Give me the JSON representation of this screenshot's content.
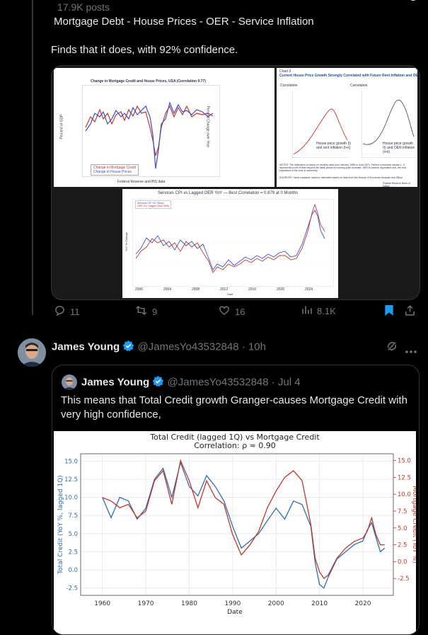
{
  "header": {
    "posts_count": "17.9K posts"
  },
  "post1": {
    "title": "Mortgage Debt - House Prices - OER - Service Inflation",
    "body": "Finds that it does, with 92% confidence.",
    "images": {
      "img1": {
        "title": "Change in Mortgage Credit and House Prices, USA (Correlation 0.77)",
        "ylabel_left": "Percent of GDP",
        "ylabel_right": "Percent Change over Year",
        "legend": [
          "Change in Mortgage Credit",
          "Change in House Prices"
        ],
        "source": "Federal Reserve and BIS data"
      },
      "img2": {
        "chart_label": "Chart 3",
        "title": "Current House Price Growth Strongly Correlated with Future Rent Inflation and OER Inflation",
        "panel_y_label": "Correlation",
        "panel1_legend": "House price growth (t) and rent inflation (t+k)",
        "panel2_legend": "House price growth (t) and OER inflation (t+k)",
        "x_ticks": [
          "-40",
          "-20",
          "0",
          "20",
          "40"
        ],
        "y_ticks": [
          "0.8",
          "0.7",
          "0.6",
          "0.5",
          "0.4",
          "0.3",
          "0.2",
          "0.1",
          "0.0",
          "-0.1",
          "-0.2"
        ],
        "notes": "NOTES: The estimation is based on monthly data from January 1986 to June 2021. Perfect correlation equals 1. 'k' represents a unit of time beyond the initial period of housing price increase. OER is owners' equivalent rent, the rent equivalent of the cost of ownership.",
        "sources": "SOURCES: Haver Analytics; authors' estimates based on data from the Bureau of Economic Analysis and Zillow.",
        "footer": "Federal Reserve Bank of Dallas"
      },
      "img3": {
        "title": "Services CPI vs Lagged OER YoY — Best Correlation = 0.879 at 0 Months",
        "legend": [
          "Services CPI YoY (Blue)",
          "OER YoY Lagged (Red-Shift)"
        ],
        "xlabel": "Date",
        "ylabel": "YoY % Change",
        "x_ticks": [
          "2000",
          "2004",
          "2008",
          "2012",
          "2016",
          "2020",
          "2024"
        ],
        "y_ticks": [
          "0",
          "2",
          "4",
          "6",
          "8"
        ]
      }
    },
    "actions": {
      "replies": "11",
      "reposts": "9",
      "likes": "16",
      "views": "8.1K"
    }
  },
  "post2": {
    "author_name": "James Young",
    "handle_time": "@JamesYo43532848 · 10h",
    "quote": {
      "author_name": "James Young",
      "handle_time": "@JamesYo43532848 · Jul 4",
      "text": "This means that Total Credit growth Granger-causes Mortgage Credit with very high confidence,"
    }
  },
  "colors": {
    "blue": "#2f6db5",
    "red": "#c0392b",
    "verified": "#1d9bf0",
    "bg": "#000000"
  },
  "chart_data": {
    "type": "line",
    "title": "Total Credit (lagged 1Q) vs Mortgage Credit",
    "subtitle": "Correlation: ρ ≈ 0.90",
    "xlabel": "Date",
    "ylabel_left": "Total Credit (YoY %, lagged 1Q)",
    "ylabel_right": "Mortgage Credit (YoY %)",
    "x_ticks": [
      1960,
      1970,
      1980,
      1990,
      2000,
      2010,
      2020
    ],
    "y_ticks_left": [
      -2.5,
      0.0,
      2.5,
      5.0,
      7.5,
      10.0,
      12.5,
      15.0
    ],
    "y_ticks_right": [
      -2.5,
      0.0,
      2.5,
      5.0,
      7.5,
      10.0,
      12.5,
      15.0
    ],
    "xlim": [
      1955,
      2027
    ],
    "ylim_left": [
      -3.5,
      16.0
    ],
    "ylim_right": [
      -5.0,
      16.0
    ],
    "grid": true,
    "series": [
      {
        "axis": "left",
        "x": [
          1960,
          1962,
          1964,
          1966,
          1968,
          1970,
          1972,
          1974,
          1976,
          1978,
          1980,
          1982,
          1984,
          1986,
          1988,
          1990,
          1992,
          1994,
          1996,
          1998,
          2000,
          2002,
          2004,
          2006,
          2008,
          2009,
          2010,
          2011,
          2012,
          2014,
          2016,
          2018,
          2020,
          2021,
          2022,
          2023,
          2024,
          2025
        ],
        "y": [
          10.0,
          7.2,
          10.0,
          9.5,
          7.0,
          8.5,
          12.5,
          14.0,
          10.0,
          14.8,
          11.5,
          10.2,
          13.0,
          11.5,
          9.5,
          6.0,
          3.0,
          4.0,
          5.0,
          6.8,
          8.5,
          7.0,
          9.5,
          9.0,
          6.0,
          1.0,
          -2.0,
          -2.5,
          -1.0,
          1.5,
          2.5,
          3.5,
          4.0,
          5.5,
          6.5,
          4.5,
          2.5,
          3.0
        ]
      },
      {
        "axis": "right",
        "x": [
          1960,
          1962,
          1964,
          1966,
          1968,
          1970,
          1972,
          1974,
          1976,
          1978,
          1980,
          1982,
          1984,
          1986,
          1988,
          1990,
          1992,
          1994,
          1996,
          1998,
          2000,
          2002,
          2004,
          2006,
          2008,
          2009,
          2010,
          2011,
          2012,
          2014,
          2016,
          2018,
          2020,
          2021,
          2022,
          2023,
          2024,
          2025
        ],
        "y": [
          9.5,
          9.0,
          8.0,
          8.5,
          6.5,
          7.5,
          12.0,
          13.5,
          8.5,
          15.0,
          12.0,
          8.0,
          12.0,
          9.5,
          8.5,
          4.0,
          1.0,
          2.5,
          4.5,
          8.0,
          10.5,
          12.5,
          13.5,
          12.0,
          5.5,
          0.5,
          -1.5,
          -2.5,
          -2.0,
          0.5,
          2.0,
          3.0,
          3.5,
          4.5,
          6.5,
          4.0,
          2.5,
          2.5
        ]
      }
    ]
  }
}
